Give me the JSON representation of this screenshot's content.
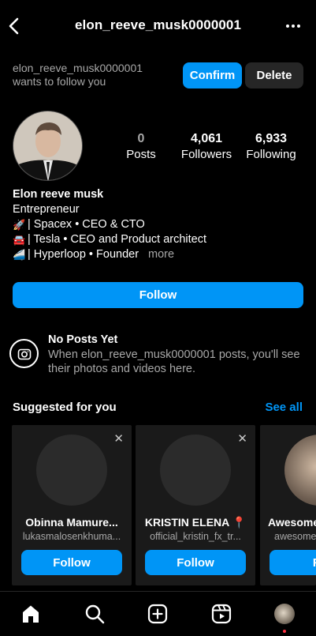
{
  "header": {
    "title": "elon_reeve_musk0000001",
    "back_icon": "chevron-left-icon",
    "more_icon": "more-horizontal-icon"
  },
  "follow_request": {
    "line1": "elon_reeve_musk0000001",
    "line2": "wants to follow you",
    "confirm_label": "Confirm",
    "delete_label": "Delete"
  },
  "stats": {
    "posts_count": "0",
    "posts_label": "Posts",
    "followers_count": "4,061",
    "followers_label": "Followers",
    "following_count": "6,933",
    "following_label": "Following"
  },
  "bio": {
    "name": "Elon reeve musk",
    "category": "Entrepreneur",
    "lines": [
      {
        "emoji": "🚀",
        "text": "| Spacex • CEO & CTO"
      },
      {
        "emoji": "🚘",
        "text": "| Tesla • CEO and Product architect"
      },
      {
        "emoji": "🚄",
        "text": "| Hyperloop • Founder"
      }
    ],
    "more_label": "more"
  },
  "follow_button": "Follow",
  "no_posts": {
    "title": "No Posts Yet",
    "subtitle": "When elon_reeve_musk0000001 posts, you'll see their photos and videos here."
  },
  "suggested": {
    "title": "Suggested for you",
    "see_all": "See all",
    "cards": [
      {
        "name": "Obinna Mamure...",
        "username": "lukasmalosenkhuma...",
        "follow_label": "Follow"
      },
      {
        "name": "KRISTIN ELENA 📍",
        "username": "official_kristin_fx_tr...",
        "follow_label": "Follow"
      },
      {
        "name": "Awesome",
        "username": "awesome",
        "follow_label": "Fo"
      }
    ]
  },
  "tabbar": {
    "items": [
      "home-icon",
      "search-icon",
      "create-icon",
      "reels-icon",
      "profile-icon"
    ]
  },
  "colors": {
    "accent": "#0095f6",
    "background": "#000000",
    "secondary_button": "#262626",
    "muted_text": "#a8a8a8",
    "notification_dot": "#ff3040"
  }
}
